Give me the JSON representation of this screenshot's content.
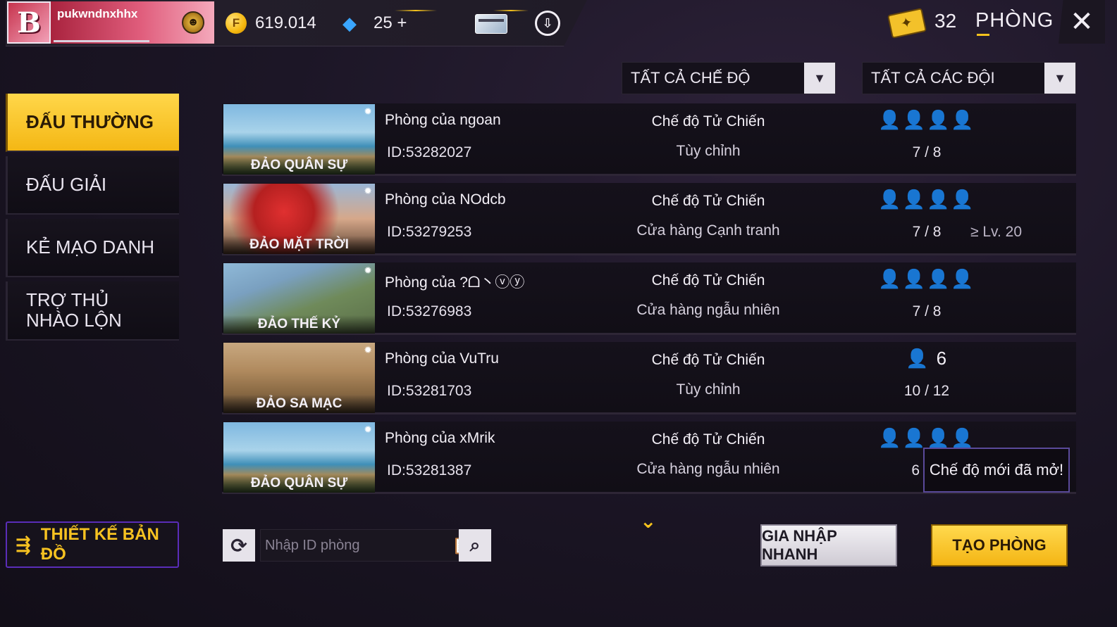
{
  "header": {
    "username": "pukwndnxhhx",
    "avatar_letter": "B",
    "coins": "619.014",
    "diamonds": "25 +",
    "tickets": "32",
    "page_title": "PHÒNG",
    "icons": {
      "coin": "coin-icon",
      "diamond": "diamond-icon",
      "card": "card-icon",
      "cloud": "cloud-download-icon",
      "ticket": "ticket-icon",
      "close": "close-icon"
    },
    "accent_color": "#f5c21d"
  },
  "sidebar": {
    "tabs": [
      {
        "label": "ĐẤU THƯỜNG",
        "active": true
      },
      {
        "label": "ĐẤU GIẢI",
        "active": false
      },
      {
        "label": "KẺ MẠO DANH",
        "active": false
      },
      {
        "label": "TRỢ THỦ NHÀO LỘN",
        "active": false
      }
    ],
    "design_map_label": "THIẾT KẾ BẢN ĐỒ"
  },
  "filters": {
    "mode": "TẤT CẢ CHẾ ĐỘ",
    "team": "TẤT CẢ CÁC ĐỘI"
  },
  "rooms": [
    {
      "map": "ĐẢO QUÂN SỰ",
      "name": "Phòng của ngoan",
      "id": "ID:53282027",
      "mode": "Chế độ Tử Chiến",
      "sub": "Tùy chỉnh",
      "players": "4 slots",
      "count": "7 / 8",
      "level": ""
    },
    {
      "map": "ĐẢO MẶT TRỜI",
      "name": "Phòng của NOdcb",
      "id": "ID:53279253",
      "mode": "Chế độ Tử Chiến",
      "sub": "Cửa hàng Cạnh tranh",
      "players": "4 slots",
      "count": "7 / 8",
      "level": "≥ Lv. 20"
    },
    {
      "map": "ĐẢO THẾ KỶ",
      "name": "Phòng của ?ᗝ丶ⓥⓨ",
      "id": "ID:53276983",
      "mode": "Chế độ Tử Chiến",
      "sub": "Cửa hàng ngẫu nhiên",
      "players": "4 slots",
      "count": "7 / 8",
      "level": ""
    },
    {
      "map": "ĐẢO SA MẠC",
      "name": "Phòng của VuTru",
      "id": "ID:53281703",
      "mode": "Chế độ Tử Chiến",
      "sub": "Tùy chỉnh",
      "players": "6",
      "count": "10 / 12",
      "level": ""
    },
    {
      "map": "ĐẢO QUÂN SỰ",
      "name": "Phòng của xMrik",
      "id": "ID:53281387",
      "mode": "Chế độ Tử Chiến",
      "sub": "Cửa hàng ngẫu nhiên",
      "players": "4 slots",
      "count": "6",
      "level": ""
    }
  ],
  "tooltip": "Chế độ mới đã mở!",
  "search": {
    "placeholder": "Nhập ID phòng",
    "value": ""
  },
  "actions": {
    "quick_join": "GIA NHẬP NHANH",
    "create_room": "TẠO PHÒNG"
  }
}
